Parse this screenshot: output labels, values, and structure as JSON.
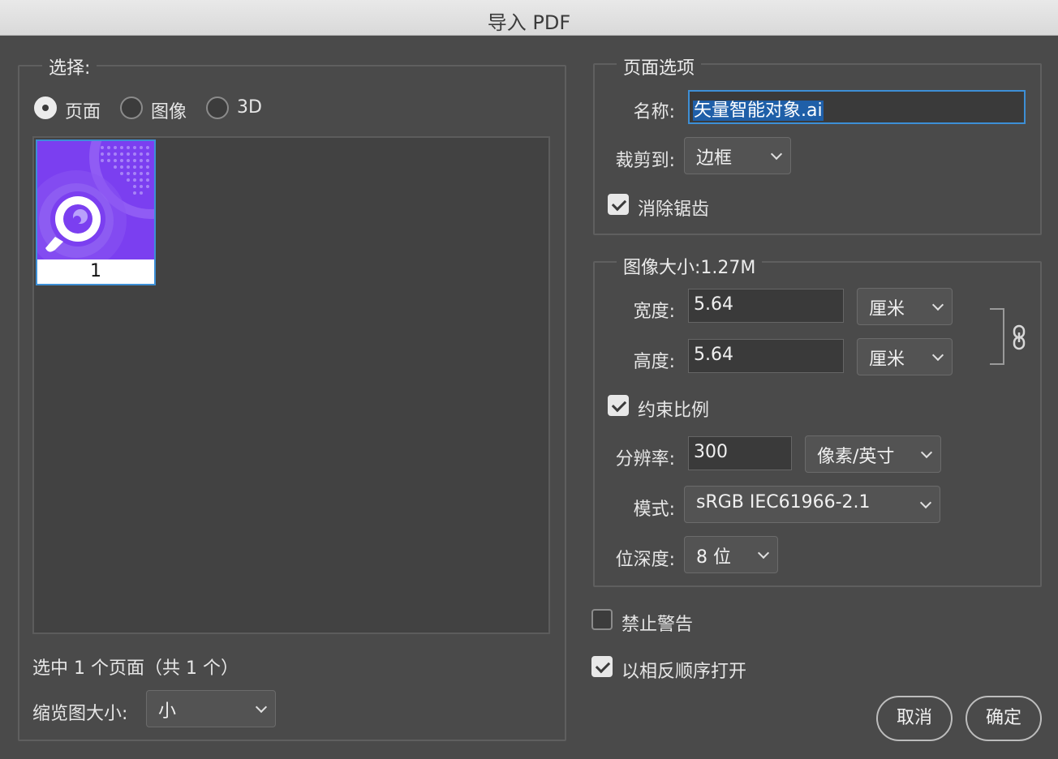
{
  "window": {
    "title": "导入 PDF"
  },
  "select_group": {
    "legend": "选择:",
    "radios": [
      {
        "label": "页面",
        "checked": true
      },
      {
        "label": "图像",
        "checked": false
      },
      {
        "label": "3D",
        "checked": false
      }
    ],
    "thumbnail": {
      "page_number": "1",
      "icon": "magnifier-eye-icon"
    },
    "status": "选中 1 个页面（共 1 个）",
    "thumb_size_label": "缩览图大小:",
    "thumb_size_value": "小"
  },
  "page_options": {
    "legend": "页面选项",
    "name_label": "名称:",
    "name_value": "矢量智能对象.ai",
    "crop_label": "裁剪到:",
    "crop_value": "边框",
    "antialias_label": "消除锯齿",
    "antialias_checked": true
  },
  "image_size": {
    "legend": "图像大小:1.27M",
    "width_label": "宽度:",
    "width_value": "5.64",
    "width_unit": "厘米",
    "height_label": "高度:",
    "height_value": "5.64",
    "height_unit": "厘米",
    "link_icon": "chain-link-icon",
    "constrain_label": "约束比例",
    "constrain_checked": true,
    "resolution_label": "分辨率:",
    "resolution_value": "300",
    "resolution_unit": "像素/英寸",
    "mode_label": "模式:",
    "mode_value": "sRGB IEC61966-2.1",
    "depth_label": "位深度:",
    "depth_value": "8 位"
  },
  "options": {
    "suppress_warnings_label": "禁止警告",
    "suppress_warnings_checked": false,
    "reverse_order_label": "以相反顺序打开",
    "reverse_order_checked": true
  },
  "buttons": {
    "cancel": "取消",
    "ok": "确定"
  },
  "colors": {
    "dialog_bg": "#4a4a4a",
    "accent": "#3d8fd6",
    "thumb_purple": "#7b3ff0"
  }
}
